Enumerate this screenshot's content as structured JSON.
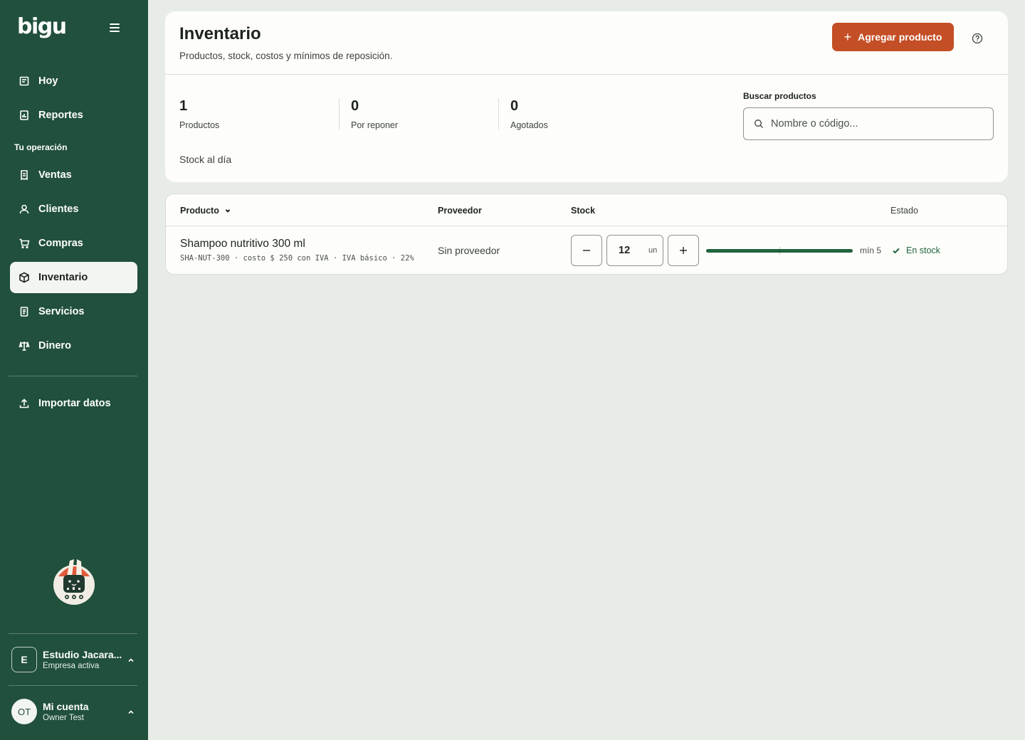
{
  "app": {
    "brand": "bigu"
  },
  "sidebar": {
    "items_top": [
      {
        "label": "Hoy",
        "icon": "calendar-icon"
      },
      {
        "label": "Reportes",
        "icon": "report-icon"
      }
    ],
    "section_label": "Tu operación",
    "items": [
      {
        "label": "Ventas",
        "icon": "receipt-icon"
      },
      {
        "label": "Clientes",
        "icon": "user-icon"
      },
      {
        "label": "Compras",
        "icon": "cart-icon"
      },
      {
        "label": "Inventario",
        "icon": "box-icon",
        "active": true
      },
      {
        "label": "Servicios",
        "icon": "document-icon"
      },
      {
        "label": "Dinero",
        "icon": "scale-icon"
      }
    ],
    "import_label": "Importar datos",
    "org": {
      "initial": "E",
      "name": "Estudio Jacara...",
      "status": "Empresa activa"
    },
    "account": {
      "initials": "OT",
      "title": "Mi cuenta",
      "user": "Owner Test"
    }
  },
  "header": {
    "title": "Inventario",
    "subtitle": "Productos, stock, costos y mínimos de reposición.",
    "add_button": "Agregar producto"
  },
  "stats": [
    {
      "value": "1",
      "label": "Productos"
    },
    {
      "value": "0",
      "label": "Por reponer"
    },
    {
      "value": "0",
      "label": "Agotados"
    }
  ],
  "search": {
    "label": "Buscar productos",
    "placeholder": "Nombre o código..."
  },
  "stock_note": "Stock al día",
  "table": {
    "columns": {
      "product": "Producto",
      "supplier": "Proveedor",
      "stock": "Stock",
      "status": "Estado"
    },
    "rows": [
      {
        "name": "Shampoo nutritivo 300 ml",
        "meta": "SHA-NUT-300 · costo $ 250 con IVA · IVA básico · 22%",
        "supplier": "Sin proveedor",
        "quantity": "12",
        "unit": "un",
        "stock_level": 1.0,
        "min_marker_fraction": 0.5,
        "min_label": "mín 5",
        "status": "En stock"
      }
    ]
  },
  "colors": {
    "sidebar": "#21503d",
    "accent": "#c44e25",
    "success": "#21643f",
    "background": "#e8ece7"
  }
}
